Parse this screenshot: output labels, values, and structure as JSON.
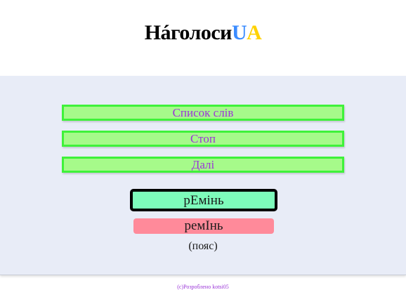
{
  "header": {
    "logo_main": "Нáголоси",
    "logo_u": "U",
    "logo_a": "A"
  },
  "menu": {
    "word_list_label": "Список слів",
    "stop_label": "Стоп",
    "next_label": "Далі"
  },
  "quiz": {
    "option_selected": "рЕмінь",
    "option_other": "ремІнь",
    "hint": "(пояс)"
  },
  "footer": {
    "text": "(c)Розроблено kotsi05"
  },
  "colors": {
    "accent_blue": "#3b8cff",
    "accent_yellow": "#ffd200",
    "button_green": "#a6fa8a",
    "button_border": "#3ff23a",
    "button_text": "#9b36d8",
    "selected_answer": "#7dfcbb",
    "wrong_answer": "#ff8a9a"
  }
}
